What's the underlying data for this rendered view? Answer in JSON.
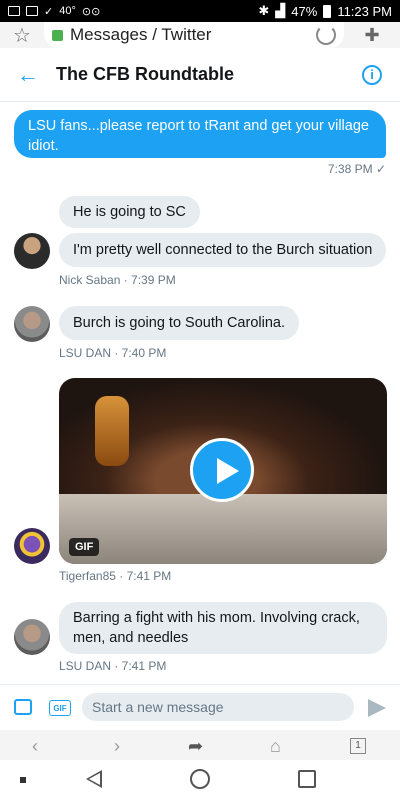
{
  "status_bar": {
    "temp": "40°",
    "battery": "47%",
    "time": "11:23 PM"
  },
  "browser": {
    "title": "Messages / Twitter"
  },
  "header": {
    "title": "The CFB Roundtable"
  },
  "messages": {
    "outgoing": {
      "text": "LSU fans...please report to tRant and get your village idiot.",
      "time": "7:38 PM ✓"
    },
    "saban_msg1": "He is going to SC",
    "saban_msg2": "I'm pretty well connected to the Burch situation",
    "saban_meta": "Nick Saban · 7:39 PM",
    "dan_msg1": "Burch is going to South Carolina.",
    "dan_meta1": "LSU DAN · 7:40 PM",
    "gif_badge": "GIF",
    "tiger_meta": "Tigerfan85 · 7:41 PM",
    "dan_msg2": "Barring a fight with his mom. Involving crack, men, and needles",
    "dan_meta2": "LSU DAN · 7:41 PM"
  },
  "composer": {
    "placeholder": "Start a new message",
    "gif_label": "GIF"
  },
  "browser_toolbar": {
    "tab_count": "1"
  },
  "colors": {
    "accent": "#1da1f2",
    "incoming_bubble": "#e6ecf0",
    "meta_text": "#657786"
  }
}
